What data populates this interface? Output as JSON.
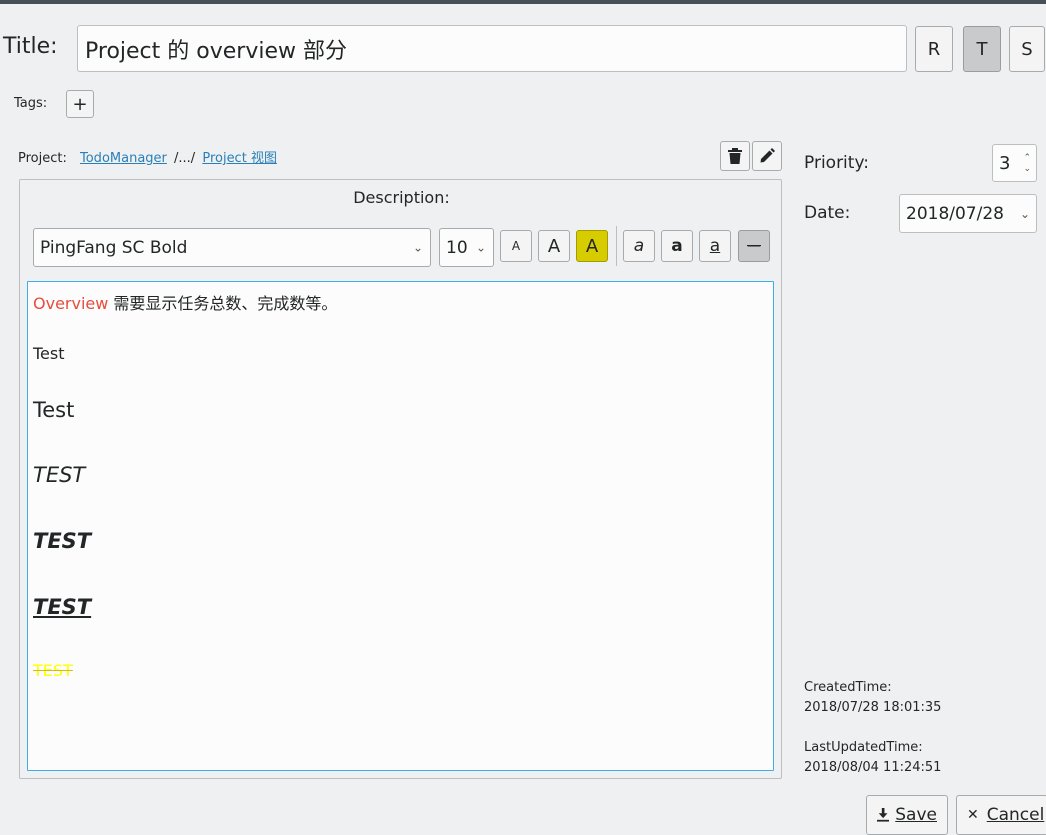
{
  "title": {
    "label": "Title:",
    "value": "Project 的 overview 部分",
    "buttons": [
      {
        "label": "R",
        "checked": false
      },
      {
        "label": "T",
        "checked": true
      },
      {
        "label": "S",
        "checked": false
      }
    ]
  },
  "tags": {
    "label": "Tags:",
    "add_label": "+"
  },
  "project": {
    "label": "Project:",
    "root_link": "TodoManager",
    "separator": "/.../",
    "leaf_link": "Project 视图"
  },
  "description": {
    "label": "Description:",
    "font": "PingFang SC Bold",
    "size": "10",
    "format_buttons": {
      "font_smaller": "A",
      "font_larger": "A",
      "highlight": "A",
      "italic": "a",
      "bold": "a",
      "underline": "a",
      "strikethrough": "—"
    },
    "content": {
      "line1_accent": "Overview",
      "line1_rest": " 需要显示任务总数、完成数等。",
      "line2": "Test",
      "line3": "Test",
      "line4": "TEST",
      "line5": "TEST",
      "line6": "TEST",
      "line7": "TEST"
    },
    "colors": {
      "accent": "#e74c3c",
      "highlight": "#d6cc00",
      "yellow_text": "#ffff00",
      "focus": "#3daee9"
    }
  },
  "side": {
    "priority_label": "Priority:",
    "priority_value": "3",
    "date_label": "Date:",
    "date_value": "2018/07/28",
    "created_label": "CreatedTime:",
    "created_value": "2018/07/28 18:01:35",
    "updated_label": "LastUpdatedTime:",
    "updated_value": "2018/08/04 11:24:51"
  },
  "actions": {
    "save_label": "Save",
    "cancel_label": "Cancel"
  }
}
